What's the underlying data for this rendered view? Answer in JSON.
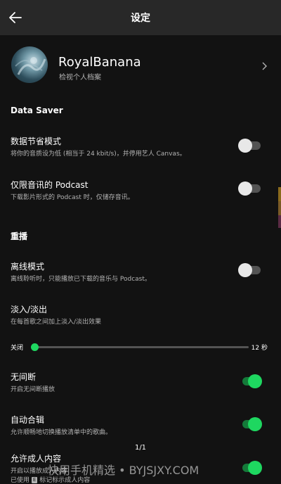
{
  "header": {
    "title": "设定"
  },
  "profile": {
    "name": "RoyalBanana",
    "subtitle": "检视个人档案"
  },
  "sections": [
    {
      "heading": "Data Saver",
      "rows": [
        {
          "title": "数据节省模式",
          "desc": "将你的音质设为低 (相当于 24 kbit/s)，并停用艺人 Canvas。",
          "on": false
        },
        {
          "title": "仅限音讯的 Podcast",
          "desc": "下载影片形式的 Podcast 时，仅储存音讯。",
          "on": false
        }
      ]
    },
    {
      "heading": "重播",
      "rows": [
        {
          "title": "离线模式",
          "desc": "离线聆听时，只能播放已下载的音乐与 Podcast。",
          "on": false
        },
        {
          "title": "淡入/淡出",
          "desc": "在每首歌之间加上淡入/淡出效果"
        },
        {
          "title": "无间断",
          "desc": "开启无间断播放",
          "on": true
        },
        {
          "title": "自动合辑",
          "desc": "允许顺畅地切换播放清单中的歌曲。",
          "on": true
        },
        {
          "title": "允许成人内容",
          "desc": "开启以播放成人内容",
          "desc2_prefix": "已使用",
          "desc2_badge": "E",
          "desc2_suffix": "标记标示成人内容",
          "on": true
        }
      ]
    }
  ],
  "crossfade": {
    "min_label": "关闭",
    "max_label": "12 秒",
    "value_seconds": 0
  },
  "pagination": "1/1",
  "watermark": "快用手机精选 • BYJSJXY.COM",
  "colors": {
    "accent": "#1ed760",
    "background": "#121212",
    "header": "#282828"
  },
  "icons": {
    "back": "back-arrow-icon",
    "chevron": "chevron-right-icon"
  }
}
